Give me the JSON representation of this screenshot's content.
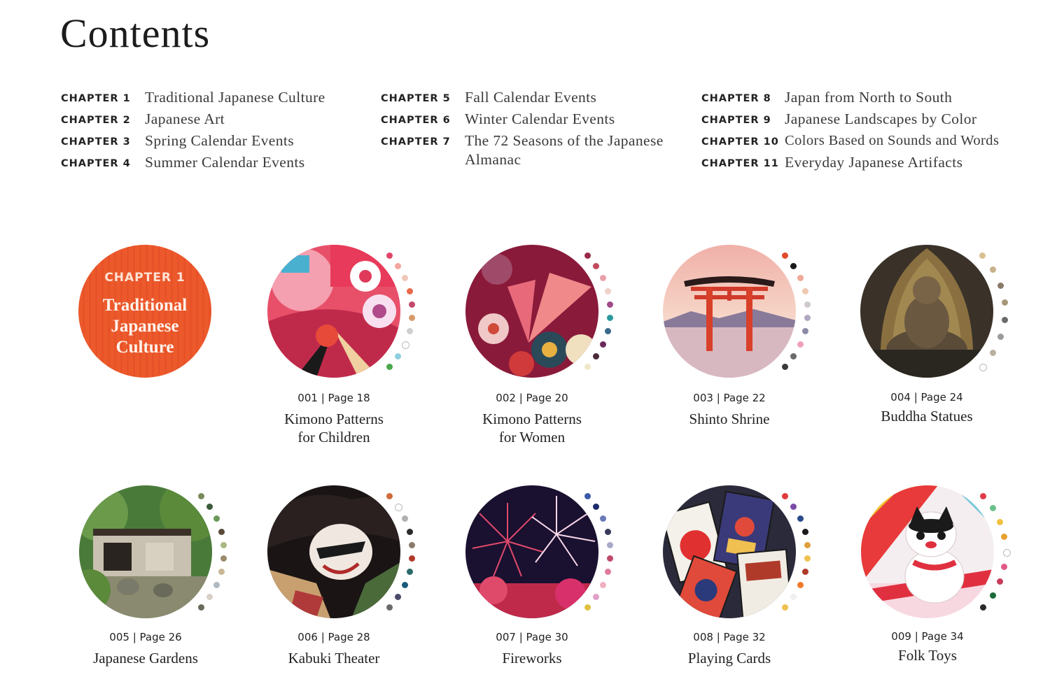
{
  "page_title": "Contents",
  "toc": {
    "columns": [
      [
        {
          "label": "CHAPTER 1",
          "title": "Traditional Japanese Culture"
        },
        {
          "label": "CHAPTER 2",
          "title": "Japanese Art"
        },
        {
          "label": "CHAPTER 3",
          "title": "Spring Calendar Events"
        },
        {
          "label": "CHAPTER 4",
          "title": "Summer Calendar Events"
        }
      ],
      [
        {
          "label": "CHAPTER 5",
          "title": "Fall Calendar Events"
        },
        {
          "label": "CHAPTER 6",
          "title": "Winter Calendar Events"
        },
        {
          "label": "CHAPTER 7",
          "title": "The 72 Seasons of the Japanese Almanac"
        }
      ],
      [
        {
          "label": "CHAPTER 8",
          "title": "Japan from North to South"
        },
        {
          "label": "CHAPTER 9",
          "title": "Japanese Landscapes by Color"
        },
        {
          "label": "CHAPTER 10",
          "title": "Colors Based on Sounds and Words"
        },
        {
          "label": "CHAPTER 11",
          "title": "Everyday Japanese Artifacts"
        }
      ]
    ]
  },
  "chapter_badge": {
    "label": "CHAPTER 1",
    "title": "Traditional\nJapanese\nCulture",
    "color": "#ec5a2c"
  },
  "entries": [
    {
      "num": "001 | Page 18",
      "title": "Kimono Patterns\nfor Children",
      "image": "kimono-children-image",
      "palette": [
        "#e0456a",
        "#f3a6a0",
        "#f0c8b8",
        "#e86a4a",
        "#c44a6a",
        "#d89a6a",
        "#cfcfcf",
        "#ffffff",
        "#8fd0e0",
        "#4aa84a"
      ]
    },
    {
      "num": "002 | Page 20",
      "title": "Kimono Patterns\nfor Women",
      "image": "kimono-women-image",
      "palette": [
        "#9a2a4a",
        "#c24a5a",
        "#e8a0a8",
        "#f0d0c8",
        "#a04a8a",
        "#2a9aa0",
        "#3a6a8a",
        "#6a2a5a",
        "#4a2a3a",
        "#f0e8c8"
      ]
    },
    {
      "num": "003 | Page 22",
      "title": "Shinto Shrine",
      "image": "shinto-shrine-image",
      "palette": [
        "#e04a2a",
        "#1a1a1a",
        "#f0a898",
        "#f0c8b0",
        "#d0c8d0",
        "#b0a8c0",
        "#8a8aa8",
        "#f0a0b8",
        "#6a6a6a",
        "#3a3a3a"
      ]
    },
    {
      "num": "004 | Page 24",
      "title": "Buddha Statues",
      "image": "buddha-statue-image",
      "palette": [
        "#d8c090",
        "#c8b088",
        "#8a7a6a",
        "#a89878",
        "#6a6a6a",
        "#9a9a9a",
        "#bab0a0",
        "#ffffff"
      ]
    },
    {
      "num": "005 | Page 26",
      "title": "Japanese Gardens",
      "image": "japanese-garden-image",
      "palette": [
        "#7a8a5a",
        "#3a5a3a",
        "#6a9a5a",
        "#5a4a3a",
        "#a8b880",
        "#9a8a6a",
        "#c8b898",
        "#b0b8c0",
        "#d8d0c8",
        "#6a6a5a"
      ]
    },
    {
      "num": "006 | Page 28",
      "title": "Kabuki Theater",
      "image": "kabuki-theater-image",
      "palette": [
        "#d06a3a",
        "#ffffff",
        "#b0b0b0",
        "#2a2a2a",
        "#8a7a6a",
        "#b03a2a",
        "#2a6a6a",
        "#1a5a7a",
        "#4a4a6a",
        "#6a6a6a"
      ]
    },
    {
      "num": "007 | Page 30",
      "title": "Fireworks",
      "image": "fireworks-image",
      "palette": [
        "#3a5aa8",
        "#1a2a6a",
        "#6a7ab8",
        "#3a3a5a",
        "#a8a8c8",
        "#c04a6a",
        "#e07a9a",
        "#f0b0c0",
        "#e0a0c8",
        "#e0c040"
      ]
    },
    {
      "num": "008 | Page 32",
      "title": "Playing Cards",
      "image": "playing-cards-image",
      "palette": [
        "#e03a3a",
        "#7a4aa8",
        "#2a4a8a",
        "#1a1a1a",
        "#e0a040",
        "#f0c050",
        "#b03a2a",
        "#f07a2a",
        "#f0f0f0",
        "#f0c050"
      ]
    },
    {
      "num": "009 | Page 34",
      "title": "Folk Toys",
      "image": "folk-toys-image",
      "palette": [
        "#e03a4a",
        "#6ac08a",
        "#f0c040",
        "#e8a030",
        "#ffffff",
        "#e05a8a",
        "#c83a5a",
        "#1a6a3a",
        "#2a2a2a"
      ]
    }
  ]
}
